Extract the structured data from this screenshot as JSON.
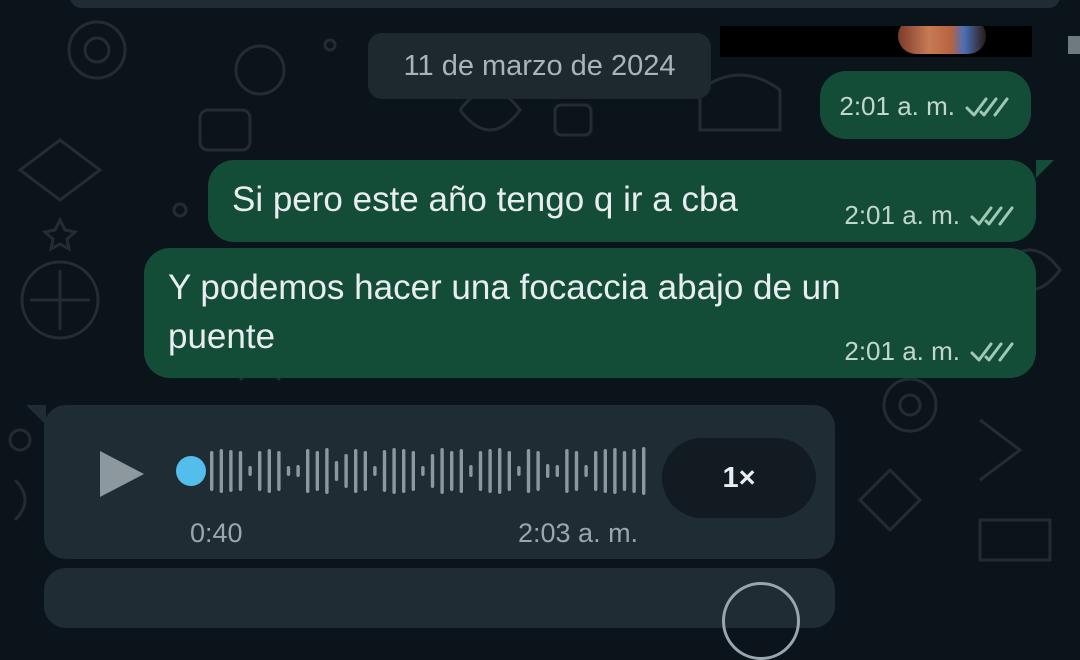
{
  "date_chip": "11 de marzo de 2024",
  "messages": [
    {
      "time": "2:01 a. m.",
      "ticks_icon": "double-check-icon"
    },
    {
      "text": "Si pero este año tengo q ir a cba",
      "time": "2:01 a. m.",
      "ticks_icon": "double-check-icon"
    },
    {
      "text_line1": "Y podemos hacer una focaccia abajo de un",
      "text_line2": "puente",
      "time": "2:01 a. m.",
      "ticks_icon": "double-check-icon"
    }
  ],
  "voice_message": {
    "duration": "0:40",
    "time": "2:03 a. m.",
    "speed": "1×",
    "progress": 0.0,
    "play_icon": "play-icon"
  },
  "colors": {
    "background": "#0b141a",
    "outgoing_bubble": "#144d37",
    "incoming_bubble": "#1f2c34",
    "progress_dot": "#53bdeb",
    "ticks_read": "#9fc8b5"
  }
}
